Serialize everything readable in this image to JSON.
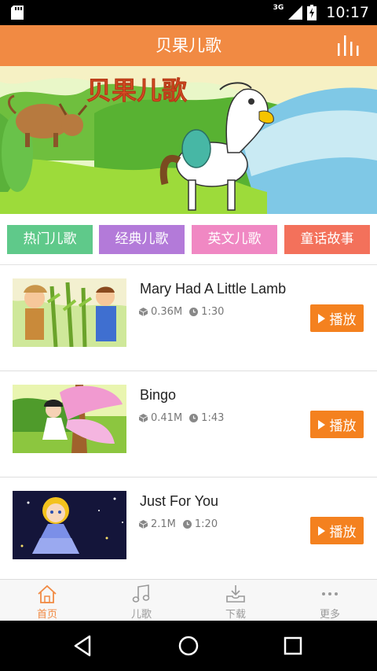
{
  "status_bar": {
    "network": "3G",
    "time": "10:17"
  },
  "app_bar": {
    "title": "贝果儿歌",
    "menu_icon": "equalizer-icon"
  },
  "banner": {
    "logo_text": "贝果儿歌"
  },
  "categories": [
    {
      "label": "热门儿歌",
      "color": "#5fc98a"
    },
    {
      "label": "经典儿歌",
      "color": "#b37ad9"
    },
    {
      "label": "英文儿歌",
      "color": "#f088c3"
    },
    {
      "label": "童话故事",
      "color": "#f3715b"
    }
  ],
  "songs": [
    {
      "title": "Mary Had A Little Lamb",
      "size": "0.36M",
      "duration": "1:30",
      "play_label": "播放"
    },
    {
      "title": "Bingo",
      "size": "0.41M",
      "duration": "1:43",
      "play_label": "播放"
    },
    {
      "title": "Just For You",
      "size": "2.1M",
      "duration": "1:20",
      "play_label": "播放"
    }
  ],
  "tabs": [
    {
      "label": "首页",
      "icon": "home-icon",
      "active": true
    },
    {
      "label": "儿歌",
      "icon": "music-note-icon",
      "active": false
    },
    {
      "label": "下载",
      "icon": "download-icon",
      "active": false
    },
    {
      "label": "更多",
      "icon": "more-icon",
      "active": false
    }
  ],
  "colors": {
    "accent": "#f18a43",
    "play_button": "#f4811f"
  }
}
